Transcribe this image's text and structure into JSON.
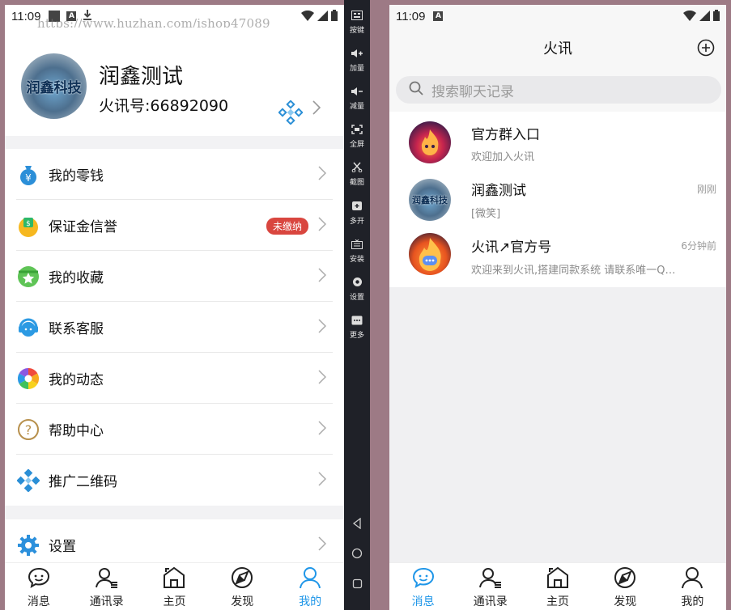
{
  "left_phone": {
    "status": {
      "time": "11:09"
    },
    "watermark": "https://www.huzhan.com/ishop47089",
    "profile": {
      "avatar_text": "润鑫科技",
      "name": "润鑫测试",
      "account_id": "火讯号:66892090"
    },
    "menu_group1": [
      {
        "label": "我的零钱",
        "icon": "money-bag-icon"
      },
      {
        "label": "保证金信誉",
        "icon": "deposit-icon",
        "badge": "未缴纳"
      },
      {
        "label": "我的收藏",
        "icon": "favorites-icon"
      },
      {
        "label": "联系客服",
        "icon": "customer-service-icon"
      },
      {
        "label": "我的动态",
        "icon": "moments-icon"
      },
      {
        "label": "帮助中心",
        "icon": "help-icon"
      },
      {
        "label": "推广二维码",
        "icon": "qr-code-icon"
      }
    ],
    "menu_group2": [
      {
        "label": "设置",
        "icon": "settings-icon"
      }
    ],
    "tabs": [
      {
        "label": "消息",
        "icon": "message-icon"
      },
      {
        "label": "通讯录",
        "icon": "contacts-icon"
      },
      {
        "label": "主页",
        "icon": "home-icon"
      },
      {
        "label": "发现",
        "icon": "discover-icon"
      },
      {
        "label": "我的",
        "icon": "profile-icon",
        "active": true
      }
    ]
  },
  "toolbar": {
    "items": [
      {
        "label": "按键",
        "icon": "keymap-icon"
      },
      {
        "label": "加量",
        "icon": "volume-up-icon"
      },
      {
        "label": "减量",
        "icon": "volume-down-icon"
      },
      {
        "label": "全屏",
        "icon": "fullscreen-icon"
      },
      {
        "label": "截图",
        "icon": "screenshot-icon"
      },
      {
        "label": "多开",
        "icon": "multi-instance-icon"
      },
      {
        "label": "安装",
        "icon": "install-icon"
      },
      {
        "label": "设置",
        "icon": "settings-icon"
      },
      {
        "label": "更多",
        "icon": "more-icon"
      }
    ]
  },
  "right_phone": {
    "status": {
      "time": "11:09"
    },
    "title": "火讯",
    "search_placeholder": "搜索聊天记录",
    "chats": [
      {
        "name": "官方群入口",
        "message": "欢迎加入火讯",
        "time": ""
      },
      {
        "name": "润鑫测试",
        "message": "[微笑]",
        "time": "刚刚",
        "avatar_text": "润鑫科技"
      },
      {
        "name": "火讯↗官方号",
        "message": "欢迎来到火讯,搭建同款系统 请联系唯一Q…",
        "time": "6分钟前"
      }
    ],
    "tabs": [
      {
        "label": "消息",
        "icon": "message-icon",
        "active": true
      },
      {
        "label": "通讯录",
        "icon": "contacts-icon"
      },
      {
        "label": "主页",
        "icon": "home-icon"
      },
      {
        "label": "发现",
        "icon": "discover-icon"
      },
      {
        "label": "我的",
        "icon": "profile-icon"
      }
    ]
  },
  "colors": {
    "accent": "#1f96e8",
    "badge": "#d9463f"
  }
}
